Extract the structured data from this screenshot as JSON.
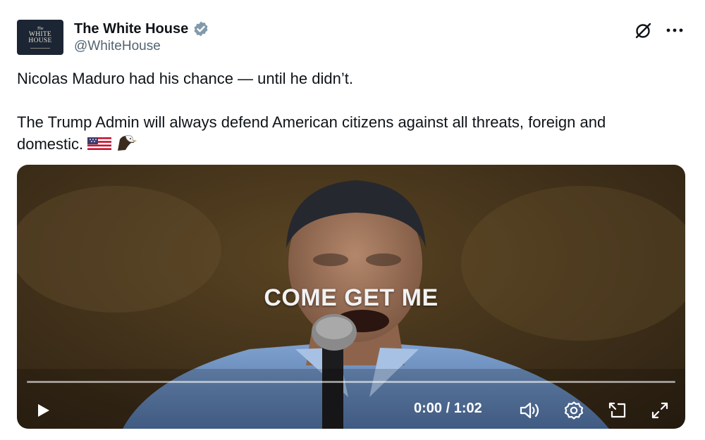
{
  "account": {
    "avatar_text": [
      "The",
      "WHITE",
      "HOUSE"
    ],
    "display_name": "The White House",
    "handle": "@WhiteHouse",
    "verified": true,
    "verified_color": "#829aab"
  },
  "header_actions": {
    "grok_icon": "grok-slash-circle-icon",
    "more_icon": "more-horizontal-icon"
  },
  "tweet": {
    "paragraph_1": "Nicolas Maduro had his chance — until he didn’t.",
    "paragraph_2": "The Trump Admin will always defend American citizens against all threats, foreign and domestic.",
    "emojis": [
      "us-flag-icon",
      "eagle-icon"
    ]
  },
  "video": {
    "caption": "COME GET ME",
    "time_display": "0:00 / 1:02",
    "progress": 0,
    "controls": [
      "play-icon",
      "volume-icon",
      "settings-icon",
      "pip-icon",
      "fullscreen-icon"
    ]
  }
}
